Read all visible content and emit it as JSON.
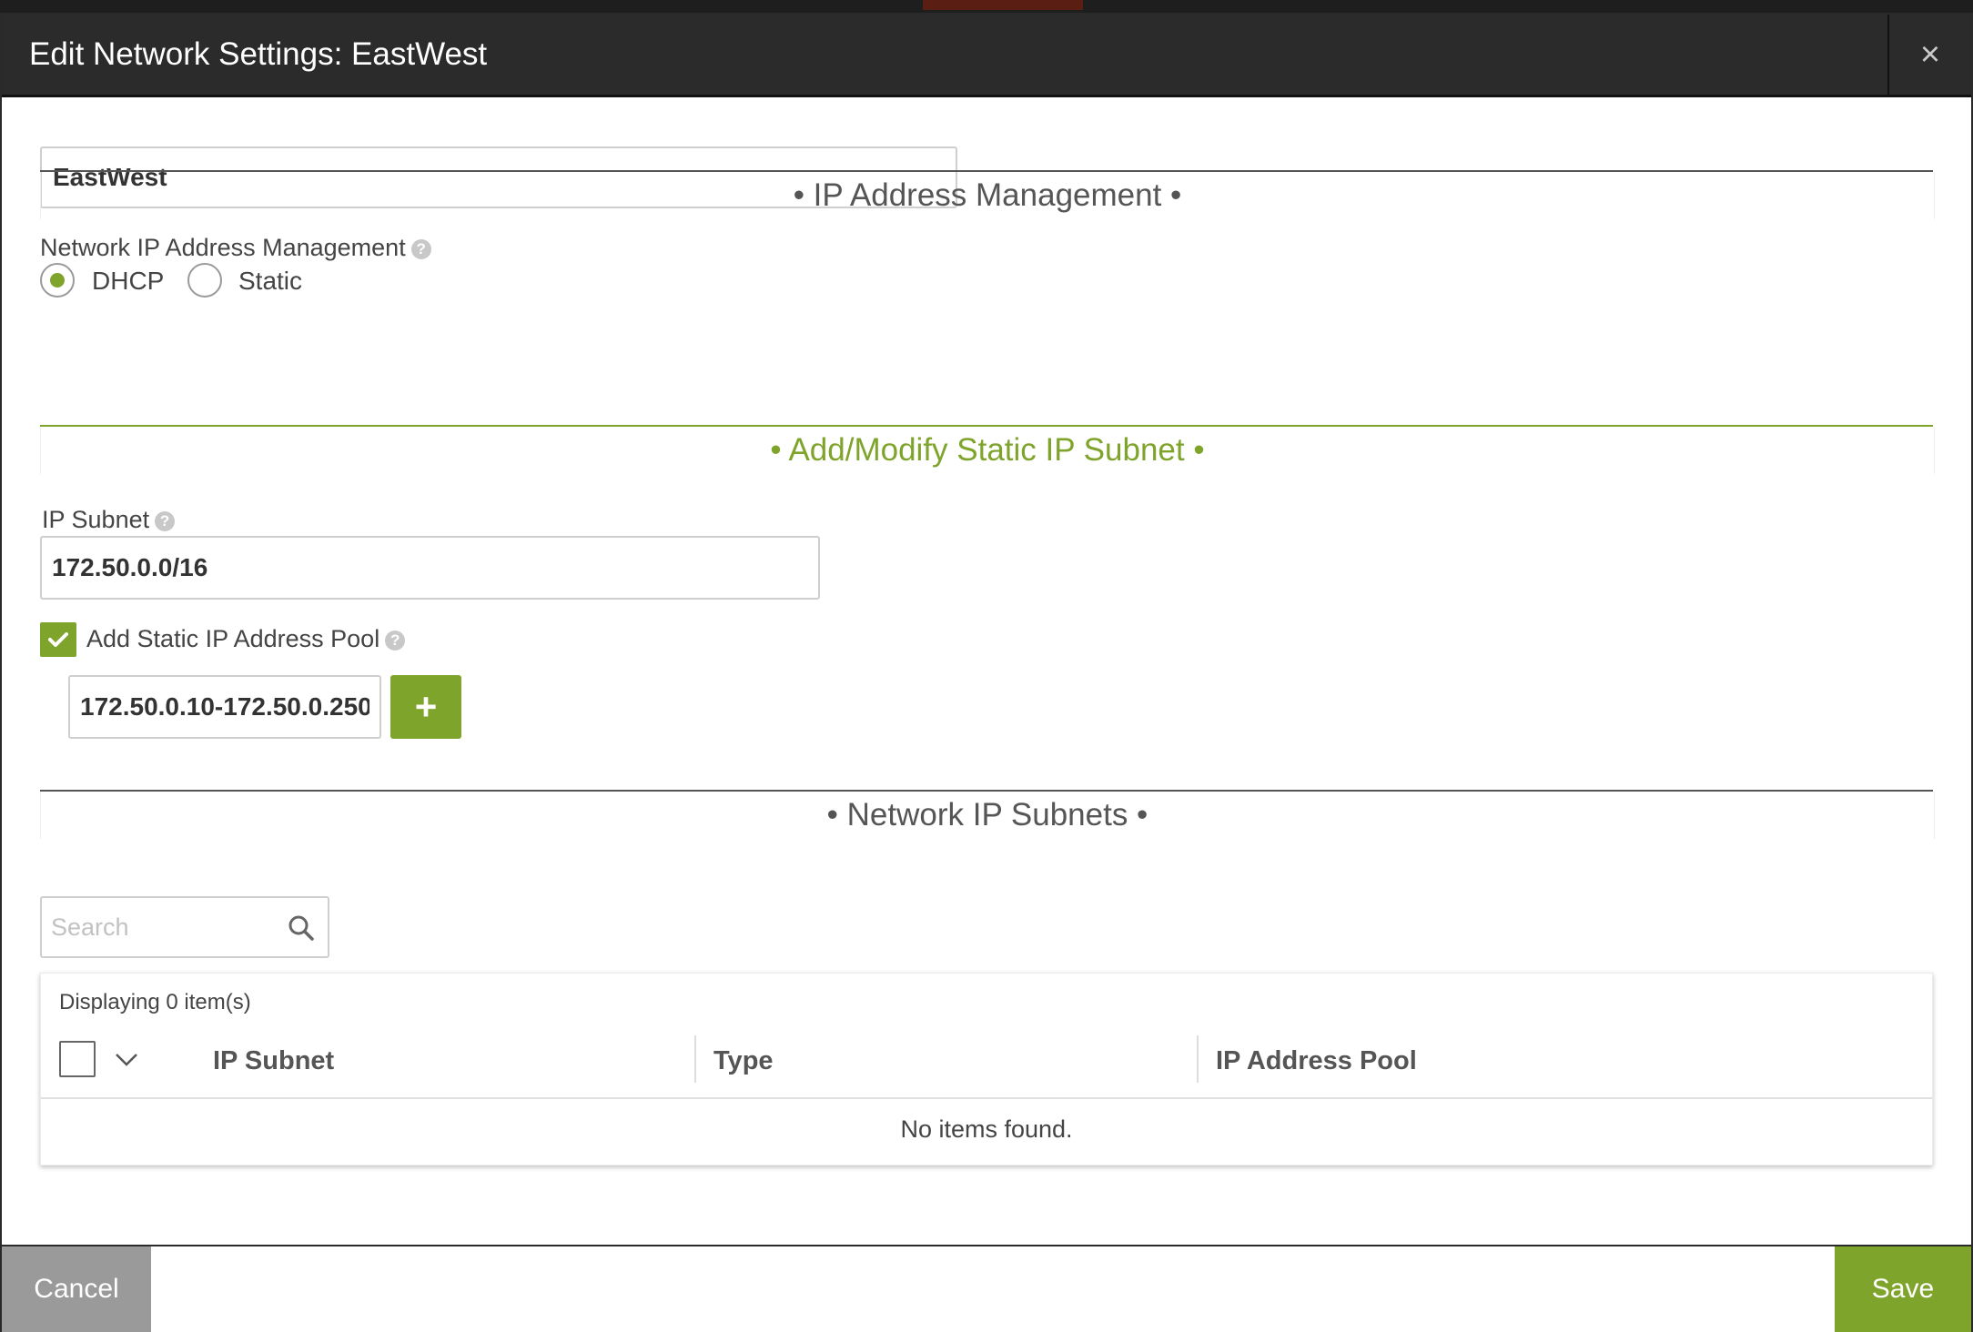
{
  "dialog": {
    "title": "Edit Network Settings: EastWest",
    "close_symbol": "×",
    "network_name_value": "EastWest"
  },
  "ipam": {
    "section_title": "• IP Address Management •",
    "field_label": "Network IP Address Management",
    "help_symbol": "?",
    "options": [
      {
        "label": "DHCP",
        "selected": true
      },
      {
        "label": "Static",
        "selected": false
      }
    ]
  },
  "static_subnet": {
    "section_title": "• Add/Modify Static IP Subnet •",
    "ip_subnet_label": "IP Subnet",
    "ip_subnet_value": "172.50.0.0/16",
    "add_pool_label": "Add Static IP Address Pool",
    "add_pool_checked": true,
    "pool_value": "172.50.0.10-172.50.0.250",
    "add_button_symbol": "+"
  },
  "subnets": {
    "section_title": "• Network IP Subnets •",
    "search_placeholder": "Search",
    "display_count": "Displaying 0 item(s)",
    "columns": [
      "IP Subnet",
      "Type",
      "IP Address Pool"
    ],
    "empty_message": "No items found."
  },
  "footer": {
    "cancel_label": "Cancel",
    "save_label": "Save"
  },
  "colors": {
    "accent_green": "#7fa42b",
    "header_bg": "#2b2b2b",
    "cancel_gray": "#9a9a9a"
  },
  "icons": [
    "close-icon",
    "help-icon",
    "check-icon",
    "plus-icon",
    "search-icon",
    "chevron-down-icon"
  ]
}
